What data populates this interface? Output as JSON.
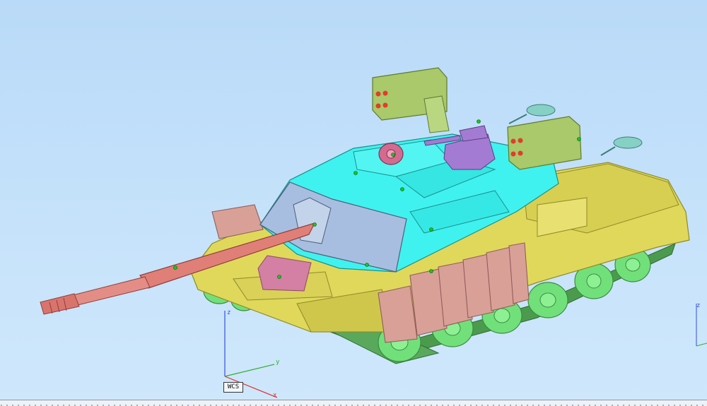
{
  "viewport": {
    "background": "#c2dff9",
    "coordinate_system_label": "WCS",
    "axes": {
      "x": "x",
      "y": "y",
      "z": "z"
    }
  },
  "colors": {
    "barrel": "#e07f78",
    "turret": "#3ff2ef",
    "turret_front": "#a8bee0",
    "hull": "#e0d85a",
    "wheels": "#72e07a",
    "side_armor": "#d9a098",
    "launchers": "#a9c96a",
    "weapon_station": "#a47bd2",
    "sensor_dome": "#d46a8f",
    "mirrors": "#86d0c6",
    "axis_x": "#e03030",
    "axis_y": "#30b030",
    "axis_z": "#3050e0"
  }
}
